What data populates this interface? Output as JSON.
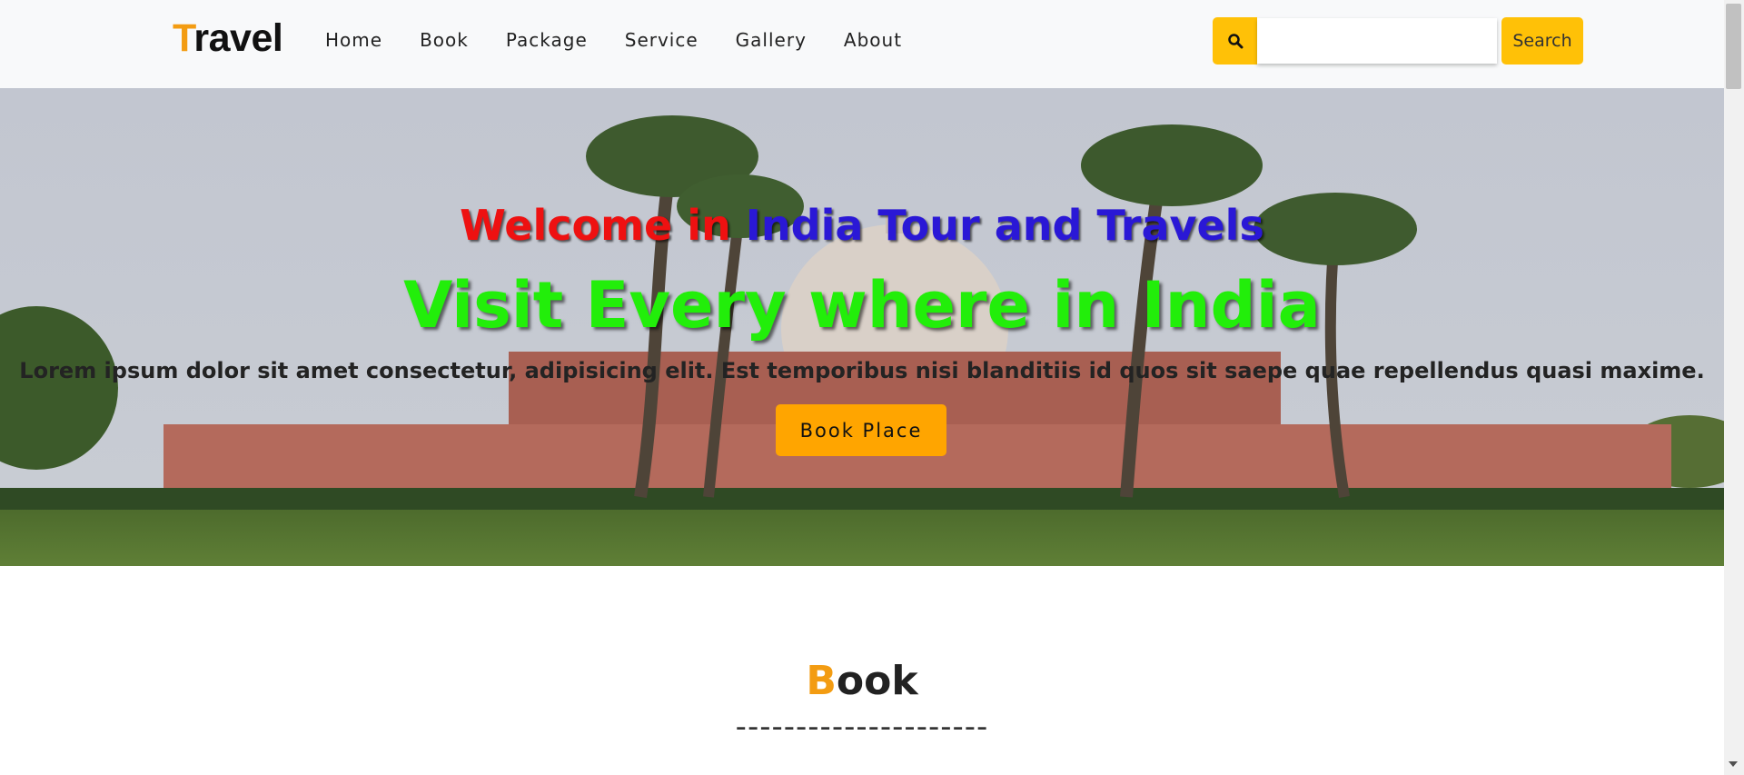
{
  "brand": {
    "first_letter": "T",
    "rest": "ravel",
    "accent_color": "#f39c12"
  },
  "nav": {
    "links": [
      {
        "label": "Home"
      },
      {
        "label": "Book"
      },
      {
        "label": "Package"
      },
      {
        "label": "Service"
      },
      {
        "label": "Gallery"
      },
      {
        "label": "About"
      }
    ]
  },
  "search": {
    "icon": "search-icon",
    "placeholder": "",
    "value": "",
    "button_label": "Search",
    "accent_color": "#ffc107"
  },
  "hero": {
    "line1_red": "Welcome in",
    "line1_blue": "India Tour and Travels",
    "line2": "Visit Every where in India",
    "line3": "Lorem ipsum dolor sit amet consectetur, adipisicing elit. Est temporibus nisi blanditiis id quos sit saepe quae repellendus quasi maxime.",
    "button_label": "Book Place",
    "colors": {
      "red": "#ee1111",
      "blue": "#2a18d6",
      "green": "#22ee0a",
      "button": "#ffa500"
    }
  },
  "section": {
    "title_first": "B",
    "title_rest": "ook",
    "divider": "---------------------"
  }
}
